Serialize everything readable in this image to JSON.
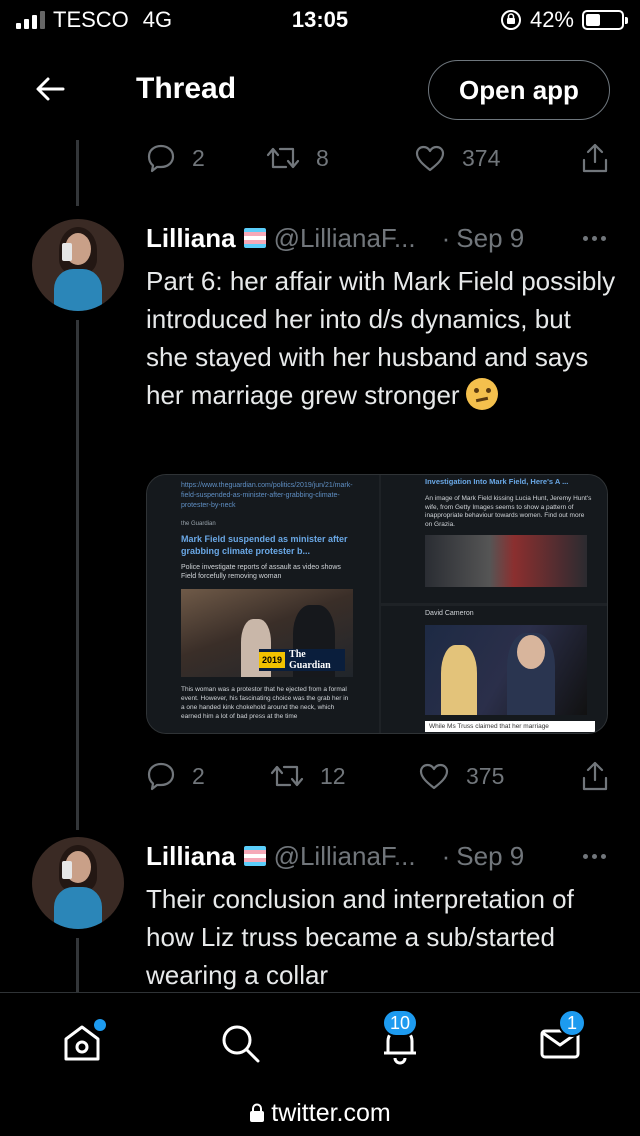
{
  "status_bar": {
    "carrier": "TESCO",
    "network": "4G",
    "time": "13:05",
    "battery": "42%",
    "battery_level": 0.42
  },
  "header": {
    "title": "Thread",
    "open_app_label": "Open app"
  },
  "top_actions": {
    "replies": "2",
    "retweets": "8",
    "likes": "374"
  },
  "tweets": [
    {
      "name": "Lilliana",
      "handle": "@LillianaF...",
      "separator": "·",
      "date": "Sep 9",
      "text": "Part 6: her affair with Mark Field possibly introduced her into d/s dynamics, but she stayed with her husband and says her marriage grew stronger",
      "emoji": "thinking-face",
      "media": {
        "left": {
          "url": "https://www.theguardian.com/politics/2019/jun/21/mark-field-suspended-as-minister-after-grabbing-climate-protester-by-neck",
          "source": "the Guardian",
          "headline": "Mark Field suspended as minister after grabbing climate protester b...",
          "subtext": "Police investigate reports of assault as video shows Field forcefully removing woman",
          "tag_year": "2019",
          "tag_brand": "The Guardian",
          "caption": "This woman was a protestor that he ejected from a formal event. However, his fascinating choice was the grab her in a one handed kink chokehold around the neck, which earned him a lot of bad press at the time"
        },
        "right_top": {
          "title": "Investigation Into Mark Field, Here's A ...",
          "text": "An image of Mark Field kissing Lucia Hunt, Jeremy Hunt's wife, from Getty Images seems to show a pattern of inappropriate behaviour towards women. Find out more on Grazia."
        },
        "right_bottom": {
          "name": "David Cameron",
          "caption": "While Ms Truss claimed that her marriage"
        }
      },
      "actions": {
        "replies": "2",
        "retweets": "12",
        "likes": "375"
      }
    },
    {
      "name": "Lilliana",
      "handle": "@LillianaF...",
      "separator": "·",
      "date": "Sep 9",
      "text": "Their conclusion and interpretation of how Liz truss became a sub/started wearing a collar"
    }
  ],
  "tabbar": {
    "notifications_badge": "10",
    "messages_badge": "1"
  },
  "url_bar": {
    "domain": "twitter.com"
  },
  "colors": {
    "background": "#000000",
    "accent": "#1d9bf0",
    "muted": "#71767b",
    "divider": "#2f3336"
  }
}
